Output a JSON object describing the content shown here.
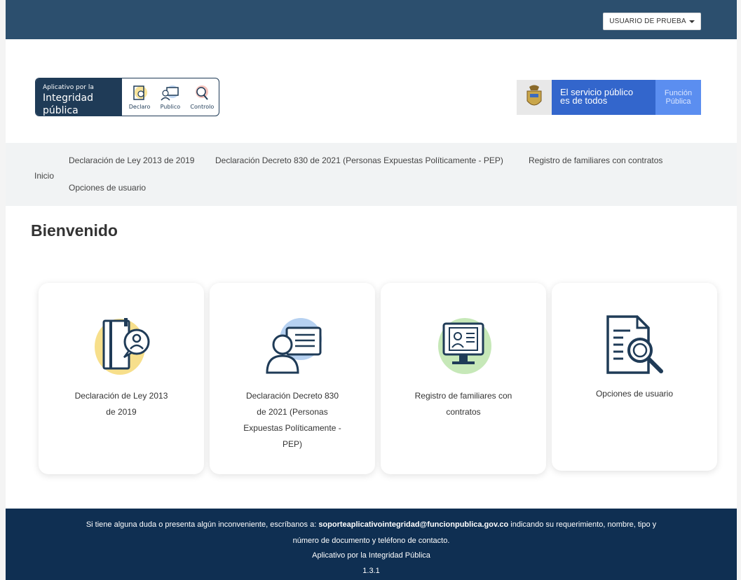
{
  "header": {
    "user_menu_label": "USUARIO DE PRUEBA"
  },
  "logo": {
    "line1": "Aplicativo por la",
    "line2": "Integridad pública",
    "icons": [
      "Declaro",
      "Publico",
      "Controlo"
    ]
  },
  "gov": {
    "text_line1": "El servicio público",
    "text_line2": "es de todos",
    "fp_line1": "Función",
    "fp_line2": "Pública"
  },
  "nav": {
    "home": "Inicio",
    "items": [
      "Declaración de Ley 2013 de 2019",
      "Declaración Decreto 830 de 2021 (Personas Expuestas Políticamente - PEP)",
      "Registro de familiares con contratos",
      "Opciones de usuario"
    ]
  },
  "main": {
    "title": "Bienvenido",
    "cards": [
      {
        "line1": "Declaración de Ley 2013",
        "line2": "de 2019"
      },
      {
        "line1": "Declaración Decreto 830",
        "line2": "de 2021 (Personas",
        "line3": "Expuestas Políticamente -",
        "line4": "PEP)"
      },
      {
        "line1": "Registro de familiares con",
        "line2": "contratos"
      },
      {
        "line1": "Opciones de usuario"
      }
    ]
  },
  "footer": {
    "line1_pre": "Si tiene alguna duda o presenta algún inconveniente, escríbanos a: ",
    "line1_email": "soporteaplicativointegridad@funcionpublica.gov.co",
    "line1_post": " indicando su requerimiento, nombre, tipo y",
    "line2": "número de documento y teléfono de contacto.",
    "line3": "Aplicativo por la Integridad Pública",
    "version": "1.3.1"
  },
  "colors": {
    "topbar": "#2c4f6e",
    "footer": "#0f2f52",
    "accent_blue": "#1f3b57",
    "gov_blue": "#3366cc"
  }
}
